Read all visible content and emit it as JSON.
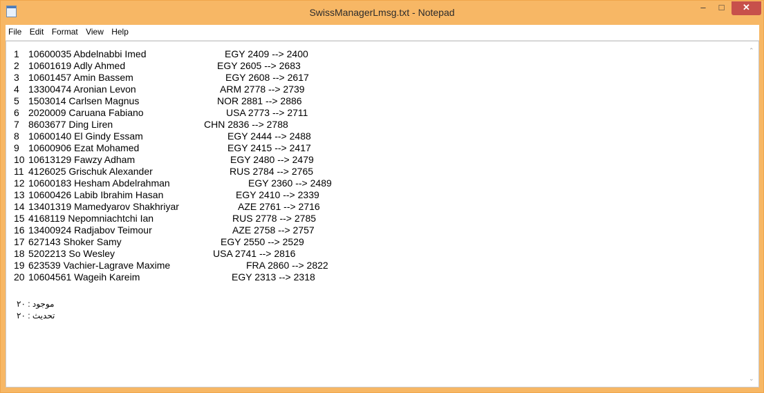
{
  "window": {
    "title": "SwissManagerLmsg.txt - Notepad",
    "controls": {
      "minimize": "–",
      "maximize": "□",
      "close": "✕"
    }
  },
  "menu": [
    "File",
    "Edit",
    "Format",
    "View",
    "Help"
  ],
  "rows": [
    {
      "num": "1",
      "id_name": "10600035 Abdelnabbi Imed",
      "rating": "EGY 2409 --> 2400"
    },
    {
      "num": "2",
      "id_name": "10601619 Adly Ahmed",
      "rating": "EGY 2605 --> 2683"
    },
    {
      "num": "3",
      "id_name": "10601457 Amin Bassem",
      "rating": "EGY 2608 --> 2617"
    },
    {
      "num": "4",
      "id_name": "13300474 Aronian Levon",
      "rating": "ARM 2778 --> 2739"
    },
    {
      "num": "5",
      "id_name": " 1503014 Carlsen Magnus",
      "rating": "NOR 2881 --> 2886"
    },
    {
      "num": "6",
      "id_name": " 2020009 Caruana Fabiano",
      "rating": "USA 2773 --> 2711"
    },
    {
      "num": "7",
      "id_name": " 8603677 Ding Liren",
      "rating": "CHN 2836 --> 2788"
    },
    {
      "num": "8",
      "id_name": "10600140 El Gindy Essam",
      "rating": "EGY 2444 --> 2488"
    },
    {
      "num": "9",
      "id_name": "10600906 Ezat Mohamed",
      "rating": "EGY 2415 --> 2417"
    },
    {
      "num": "10",
      "id_name": " 10613129 Fawzy Adham",
      "rating": "EGY 2480 --> 2479"
    },
    {
      "num": "11",
      "id_name": "  4126025 Grischuk Alexander",
      "rating": "RUS 2784 --> 2765"
    },
    {
      "num": "12",
      "id_name": " 10600183 Hesham Abdelrahman",
      "rating": "EGY 2360 --> 2489"
    },
    {
      "num": "13",
      "id_name": " 10600426 Labib Ibrahim Hasan",
      "rating": "EGY 2410 --> 2339"
    },
    {
      "num": "14",
      "id_name": " 13401319 Mamedyarov Shakhriyar",
      "rating": "AZE 2761 --> 2716"
    },
    {
      "num": "15",
      "id_name": "  4168119 Nepomniachtchi Ian",
      "rating": "RUS 2778 --> 2785"
    },
    {
      "num": "16",
      "id_name": " 13400924 Radjabov Teimour",
      "rating": "AZE 2758 --> 2757"
    },
    {
      "num": "17",
      "id_name": "   627143 Shoker Samy",
      "rating": "EGY 2550 --> 2529"
    },
    {
      "num": "18",
      "id_name": "  5202213 So Wesley",
      "rating": "USA 2741 --> 2816"
    },
    {
      "num": "19",
      "id_name": "   623539 Vachier-Lagrave Maxime",
      "rating": "FRA 2860 --> 2822"
    },
    {
      "num": "20",
      "id_name": " 10604561 Wageih Kareim",
      "rating": "EGY 2313 --> 2318"
    }
  ],
  "summary": {
    "found_line": "موجود : ٢٠",
    "updated_line": "تحديث : ٢٠"
  }
}
